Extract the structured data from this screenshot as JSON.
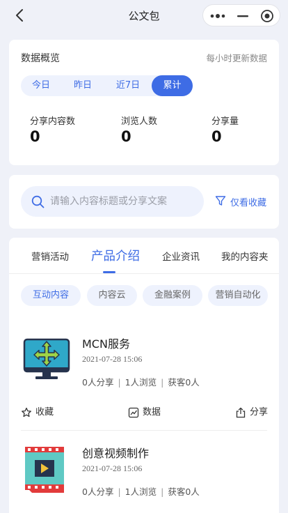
{
  "navbar": {
    "title": "公文包"
  },
  "overview": {
    "title": "数据概览",
    "note": "每小时更新数据",
    "segments": [
      "今日",
      "昨日",
      "近7日",
      "累计"
    ],
    "active_segment": "累计",
    "stats": [
      {
        "label": "分享内容数",
        "value": "0"
      },
      {
        "label": "浏览人数",
        "value": "0"
      },
      {
        "label": "分享量",
        "value": "0"
      }
    ]
  },
  "search": {
    "placeholder": "请输入内容标题或分享文案",
    "filter_label": "仅看收藏"
  },
  "tabs": [
    "营销活动",
    "产品介绍",
    "企业资讯",
    "我的内容夹"
  ],
  "active_tab": "产品介绍",
  "chips": [
    "互动内容",
    "内容云",
    "金融案例",
    "营销自动化"
  ],
  "active_chip": "互动内容",
  "items": [
    {
      "title": "MCN服务",
      "time": "2021-07-28 15:06",
      "shares": "0人分享",
      "views": "1人浏览",
      "leads": "获客0人",
      "icon": "monitor-arrows-icon"
    },
    {
      "title": "创意视频制作",
      "time": "2021-07-28 15:06",
      "shares": "0人分享",
      "views": "1人浏览",
      "leads": "获客0人",
      "icon": "video-film-icon"
    }
  ],
  "actions": {
    "favorite": "收藏",
    "data": "数据",
    "share": "分享"
  },
  "colors": {
    "accent": "#3e6ce5",
    "background": "#eff1f8",
    "chip_bg": "#eef2fd"
  }
}
